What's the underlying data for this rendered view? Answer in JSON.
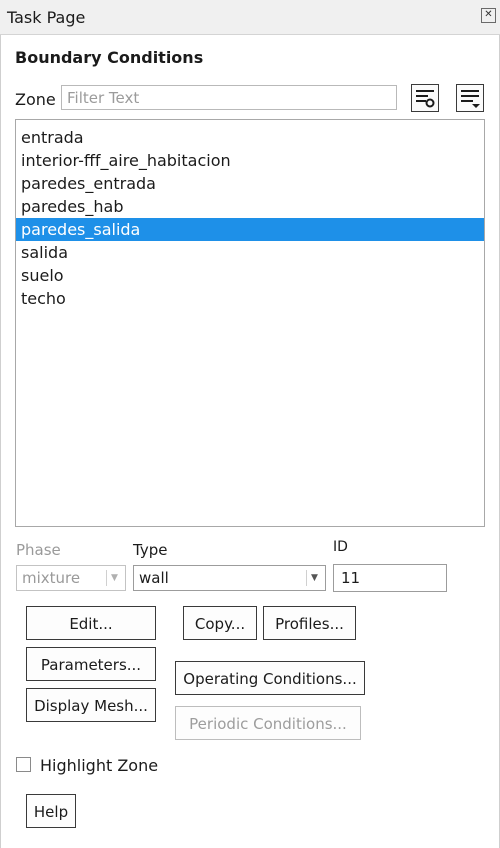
{
  "window": {
    "title": "Task Page"
  },
  "panel": {
    "heading": "Boundary Conditions",
    "zone_label": "Zone",
    "filter_placeholder": "Filter Text",
    "zones": [
      "entrada",
      "interior-fff_aire_habitacion",
      "paredes_entrada",
      "paredes_hab",
      "paredes_salida",
      "salida",
      "suelo",
      "techo"
    ],
    "selected_zone": "paredes_salida",
    "phase": {
      "label": "Phase",
      "value": "mixture"
    },
    "type": {
      "label": "Type",
      "value": "wall"
    },
    "id": {
      "label": "ID",
      "value": "11"
    },
    "buttons": {
      "edit": "Edit...",
      "copy": "Copy...",
      "profiles": "Profiles...",
      "parameters": "Parameters...",
      "operating": "Operating Conditions...",
      "display_mesh": "Display Mesh...",
      "periodic": "Periodic Conditions..."
    },
    "highlight_zone": {
      "label": "Highlight Zone",
      "checked": false
    },
    "help": "Help"
  },
  "colors": {
    "selection": "#1e90e8",
    "disabled_text": "#9a9a9a"
  },
  "icons": [
    "close-icon",
    "filter-settings-icon",
    "list-filter-icon",
    "chevron-down-icon"
  ]
}
